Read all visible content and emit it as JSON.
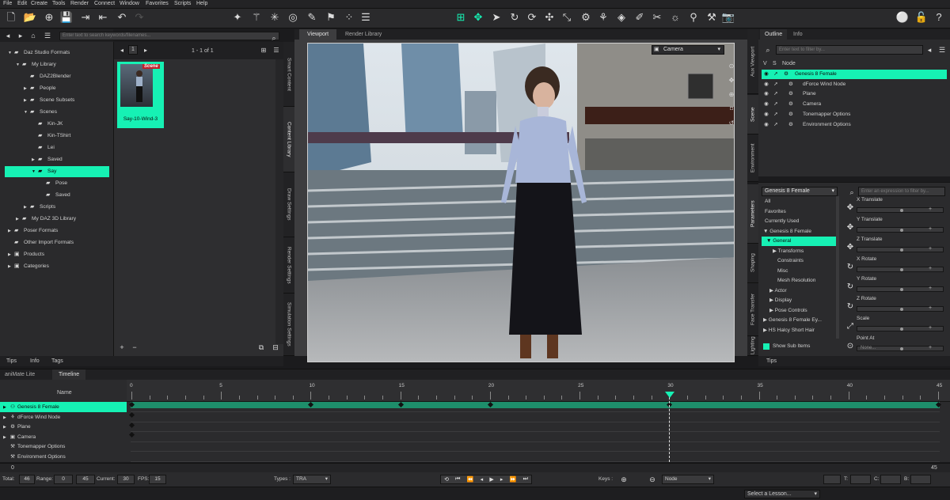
{
  "menubar": {
    "items": [
      "File",
      "Edit",
      "Create",
      "Tools",
      "Render",
      "Connect",
      "Window",
      "Favorites",
      "Scripts",
      "Help"
    ]
  },
  "left_panel": {
    "search_placeholder": "Enter text to search keywords/filenames...",
    "tree": [
      {
        "label": "Daz Studio Formats",
        "level": 0,
        "arrow": "▼",
        "icon": "folder"
      },
      {
        "label": "My Library",
        "level": 1,
        "arrow": "▼",
        "icon": "folder"
      },
      {
        "label": "DAZ2Blender",
        "level": 2,
        "arrow": "",
        "icon": "folder"
      },
      {
        "label": "People",
        "level": 2,
        "arrow": "▶",
        "icon": "folder"
      },
      {
        "label": "Scene Subsets",
        "level": 2,
        "arrow": "▶",
        "icon": "folder"
      },
      {
        "label": "Scenes",
        "level": 2,
        "arrow": "▼",
        "icon": "folder"
      },
      {
        "label": "Kin-JK",
        "level": 3,
        "arrow": "",
        "icon": "folder"
      },
      {
        "label": "Kin-TShirt",
        "level": 3,
        "arrow": "",
        "icon": "folder"
      },
      {
        "label": "Lei",
        "level": 3,
        "arrow": "",
        "icon": "folder"
      },
      {
        "label": "Saved",
        "level": 3,
        "arrow": "▶",
        "icon": "folder"
      },
      {
        "label": "Say",
        "level": 3,
        "arrow": "▼",
        "icon": "folder",
        "selected": true
      },
      {
        "label": "Pose",
        "level": 4,
        "arrow": "",
        "icon": "folder"
      },
      {
        "label": "Saved",
        "level": 4,
        "arrow": "",
        "icon": "folder"
      },
      {
        "label": "Scripts",
        "level": 2,
        "arrow": "▶",
        "icon": "folder"
      },
      {
        "label": "My DAZ 3D Library",
        "level": 1,
        "arrow": "▶",
        "icon": "folder"
      },
      {
        "label": "Poser Formats",
        "level": 0,
        "arrow": "▶",
        "icon": "folder"
      },
      {
        "label": "Other Import Formats",
        "level": 0,
        "arrow": "",
        "icon": "folder"
      },
      {
        "label": "Products",
        "level": 0,
        "arrow": "▶",
        "icon": "box"
      },
      {
        "label": "Categories",
        "level": 0,
        "arrow": "▶",
        "icon": "box"
      }
    ],
    "page_number": "1",
    "page_count": "1 - 1 of 1",
    "thumbnail": {
      "badge": "Scene",
      "label": "Say-10-Wind-3"
    },
    "bottom_tabs": [
      "Tips",
      "Info",
      "Tags"
    ]
  },
  "center_vtabs": [
    "Smart Content",
    "Content Library",
    "Draw Settings",
    "Render Settings",
    "Simulation Settings"
  ],
  "viewport": {
    "tabs": [
      "Viewport",
      "Render Library"
    ],
    "camera": "Camera"
  },
  "right_vtabs_top": [
    "Aux Viewport",
    "Scene",
    "Environment"
  ],
  "right_vtabs_bottom": [
    "Parameters",
    "Shaping",
    "Face Transfer",
    "Lighting"
  ],
  "outline": {
    "tabs": [
      "Outline",
      "Info"
    ],
    "filter_placeholder": "Enter text to filter by...",
    "header": {
      "v": "V",
      "s": "S",
      "node": "Node"
    },
    "rows": [
      {
        "label": "Genesis 8 Female",
        "selected": true
      },
      {
        "label": "dForce Wind Node"
      },
      {
        "label": "Plane"
      },
      {
        "label": "Camera"
      },
      {
        "label": "Tonemapper Options"
      },
      {
        "label": "Environment Options"
      }
    ]
  },
  "parameters": {
    "node_select": "Genesis 8 Female",
    "filter_placeholder": "Enter an expression to filter by...",
    "rows": [
      {
        "label": "All"
      },
      {
        "label": "Favorites"
      },
      {
        "label": "Currently Used"
      },
      {
        "label": "▼ Genesis 8 Female"
      },
      {
        "label": "▼ General",
        "selected": true
      },
      {
        "label": "▶ Transforms"
      },
      {
        "label": "Constraints"
      },
      {
        "label": "Misc"
      },
      {
        "label": "Mesh Resolution"
      },
      {
        "label": "▶ Actor"
      },
      {
        "label": "▶ Display"
      },
      {
        "label": "▶ Pose Controls"
      },
      {
        "label": "▶ Genesis 8 Female Ey..."
      },
      {
        "label": "▶ HS Halcy Short Hair"
      }
    ],
    "show_sub_items": "Show Sub Items",
    "sliders": [
      {
        "label": "X Translate",
        "value": ""
      },
      {
        "label": "Y Translate",
        "value": ""
      },
      {
        "label": "Z Translate",
        "value": ""
      },
      {
        "label": "X Rotate",
        "value": ""
      },
      {
        "label": "Y Rotate",
        "value": ""
      },
      {
        "label": "Z Rotate",
        "value": ""
      },
      {
        "label": "Scale",
        "value": ""
      },
      {
        "label": "Point At",
        "value": "None..."
      }
    ],
    "tips_tab": "Tips"
  },
  "timeline": {
    "tabs": [
      "aniMate Lite",
      "Timeline"
    ],
    "name_header": "Name",
    "ticks": [
      "0",
      "5",
      "10",
      "15",
      "20",
      "25",
      "30",
      "35",
      "40",
      "45"
    ],
    "rows": [
      {
        "label": "Genesis 8 Female",
        "selected": true
      },
      {
        "label": "dForce Wind Node"
      },
      {
        "label": "Plane"
      },
      {
        "label": "Camera"
      },
      {
        "label": "Tonemapper Options"
      },
      {
        "label": "Environment Options"
      }
    ],
    "range_start": "0",
    "range_end": "45",
    "current_frame": 30,
    "total_label": "Total:",
    "total": "46",
    "range_label": "Range:",
    "range_from": "0",
    "range_to": "45",
    "current_label": "Current:",
    "current": "30",
    "fps_label": "FPS:",
    "fps": "15",
    "types_label": "Types :",
    "types": "TRA",
    "keys_label": "Keys :",
    "keys_node": "Node",
    "t_label": "T:",
    "c_label": "C:",
    "b_label": "B:"
  },
  "status": {
    "lesson": "Select a Lesson..."
  },
  "colors": {
    "accent": "#16f1b4",
    "bg": "#2b2b2d",
    "dark": "#1b1b1d"
  }
}
